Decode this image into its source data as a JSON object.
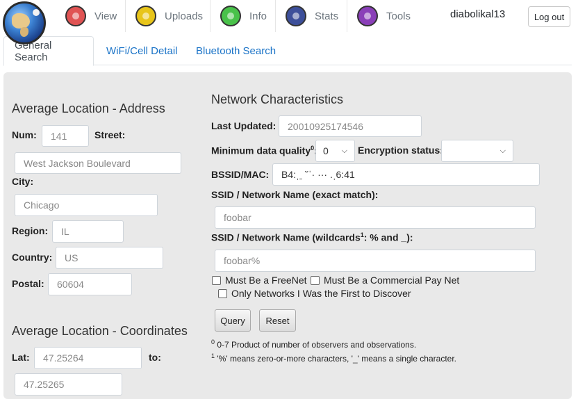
{
  "nav": {
    "items": [
      {
        "label": "View",
        "icon": "view-icon",
        "color": "#e05353"
      },
      {
        "label": "Uploads",
        "icon": "uploads-icon",
        "color": "#e8c51a"
      },
      {
        "label": "Info",
        "icon": "info-icon",
        "color": "#49c24a"
      },
      {
        "label": "Stats",
        "icon": "stats-icon",
        "color": "#3d4f9a"
      },
      {
        "label": "Tools",
        "icon": "tools-icon",
        "color": "#8a3fb8"
      }
    ],
    "username": "diabolikal13",
    "logout_label": "Log out"
  },
  "tabs": [
    {
      "label": "General Search",
      "active": true
    },
    {
      "label": "WiFi/Cell Detail",
      "active": false
    },
    {
      "label": "Bluetooth Search",
      "active": false
    }
  ],
  "address": {
    "heading": "Average Location - Address",
    "num_label": "Num:",
    "num_placeholder": "141",
    "street_label": "Street:",
    "street_placeholder": "West Jackson Boulevard",
    "city_label": "City:",
    "city_placeholder": "Chicago",
    "region_label": "Region:",
    "region_placeholder": "IL",
    "country_label": "Country:",
    "country_placeholder": "US",
    "postal_label": "Postal:",
    "postal_placeholder": "60604"
  },
  "coords": {
    "heading": "Average Location - Coordinates",
    "lat_label": "Lat:",
    "lat_from": "47.25264",
    "to_label": "to:",
    "lat_to": "47.25265"
  },
  "network": {
    "heading": "Network Characteristics",
    "last_updated_label": "Last Updated:",
    "last_updated_placeholder": "20010925174546",
    "min_quality_label": "Minimum data quality",
    "min_quality_sup": "0",
    "min_quality_value": "0",
    "encryption_label": "Encryption status:",
    "encryption_value": "",
    "bssid_label": "BSSID/MAC:",
    "bssid_value": "B4:ˌˍ ˘ˈ· ··· .ˌ6:41",
    "ssid_exact_label": "SSID / Network Name (exact match):",
    "ssid_exact_placeholder": "foobar",
    "ssid_wild_label_pre": "SSID / Network Name (wildcards",
    "ssid_wild_sup": "1",
    "ssid_wild_label_post": ": % and _):",
    "ssid_wild_placeholder": "foobar%",
    "freenet_label": "Must Be a FreeNet",
    "paynet_label": "Must Be a Commercial Pay Net",
    "first_label": "Only Networks I Was the First to Discover",
    "query_label": "Query",
    "reset_label": "Reset",
    "note0_sup": "0",
    "note0": "0-7 Product of number of observers and observations.",
    "note1_sup": "1",
    "note1": "'%' means zero-or-more characters, '_' means a single character."
  }
}
